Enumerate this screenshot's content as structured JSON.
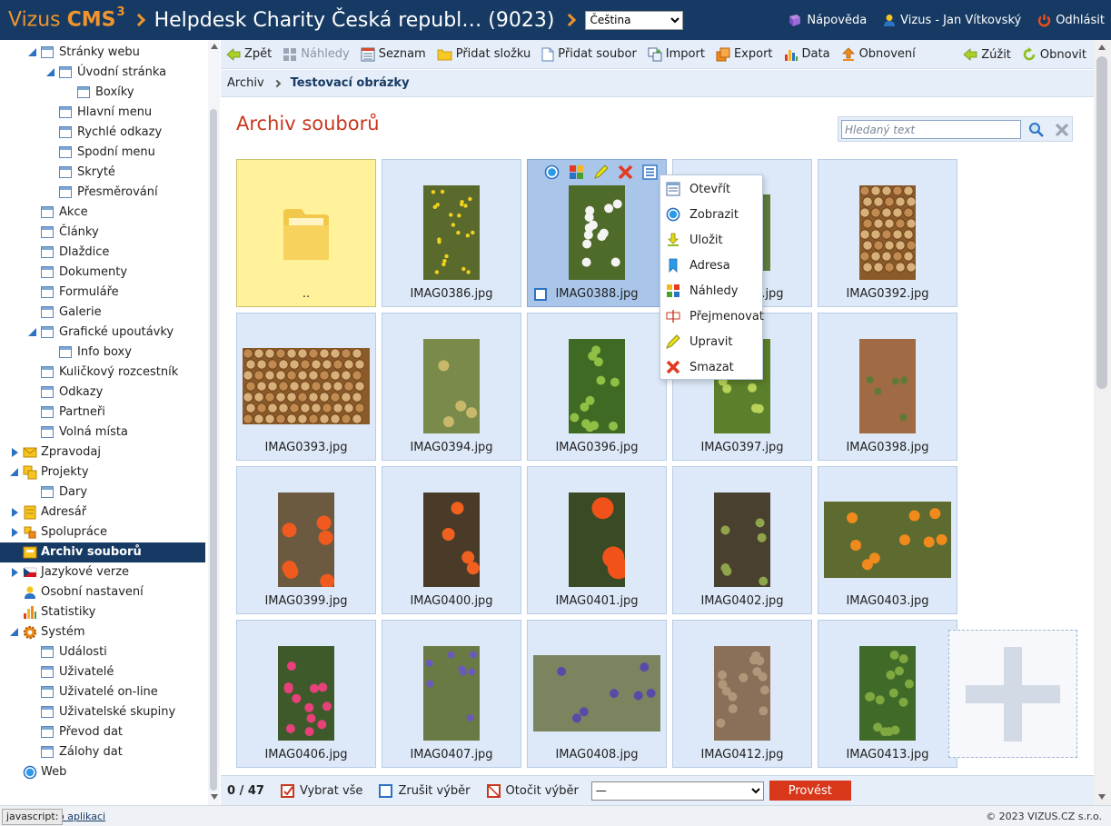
{
  "header": {
    "brand_name": "Vizus",
    "brand_product": "CMS",
    "brand_version": "3",
    "site_title": "Helpdesk Charity Česká republ… (9023)",
    "language": "Čeština",
    "help_label": "Nápověda",
    "user_label": "Vizus - Jan Vítkovský",
    "logout_label": "Odhlásit"
  },
  "sidebar": {
    "items": [
      {
        "label": "Stránky webu",
        "level": 2,
        "icon": "page",
        "expander": "open"
      },
      {
        "label": "Úvodní stránka",
        "level": 3,
        "icon": "page",
        "expander": "open"
      },
      {
        "label": "Boxíky",
        "level": 4,
        "icon": "page"
      },
      {
        "label": "Hlavní menu",
        "level": 3,
        "icon": "page"
      },
      {
        "label": "Rychlé odkazy",
        "level": 3,
        "icon": "page"
      },
      {
        "label": "Spodní menu",
        "level": 3,
        "icon": "page"
      },
      {
        "label": "Skryté",
        "level": 3,
        "icon": "page"
      },
      {
        "label": "Přesměrování",
        "level": 3,
        "icon": "page"
      },
      {
        "label": "Akce",
        "level": 2,
        "icon": "page"
      },
      {
        "label": "Články",
        "level": 2,
        "icon": "page"
      },
      {
        "label": "Dlaždice",
        "level": 2,
        "icon": "page"
      },
      {
        "label": "Dokumenty",
        "level": 2,
        "icon": "page"
      },
      {
        "label": "Formuláře",
        "level": 2,
        "icon": "page"
      },
      {
        "label": "Galerie",
        "level": 2,
        "icon": "page"
      },
      {
        "label": "Grafické upoutávky",
        "level": 2,
        "icon": "page",
        "expander": "open"
      },
      {
        "label": "Info boxy",
        "level": 3,
        "icon": "page"
      },
      {
        "label": "Kuličkový rozcestník",
        "level": 2,
        "icon": "page"
      },
      {
        "label": "Odkazy",
        "level": 2,
        "icon": "page"
      },
      {
        "label": "Partneři",
        "level": 2,
        "icon": "page"
      },
      {
        "label": "Volná místa",
        "level": 2,
        "icon": "page"
      },
      {
        "label": "Zpravodaj",
        "level": 1,
        "icon": "envelope",
        "expander": "closed"
      },
      {
        "label": "Projekty",
        "level": 1,
        "icon": "projects",
        "expander": "open"
      },
      {
        "label": "Dary",
        "level": 2,
        "icon": "page"
      },
      {
        "label": "Adresář",
        "level": 1,
        "icon": "address",
        "expander": "closed"
      },
      {
        "label": "Spolupráce",
        "level": 1,
        "icon": "cooperation",
        "expander": "closed"
      },
      {
        "label": "Archiv souborů",
        "level": 1,
        "icon": "archive",
        "selected": true
      },
      {
        "label": "Jazykové verze",
        "level": 1,
        "icon": "flag",
        "expander": "closed"
      },
      {
        "label": "Osobní nastavení",
        "level": 1,
        "icon": "user"
      },
      {
        "label": "Statistiky",
        "level": 1,
        "icon": "stats"
      },
      {
        "label": "Systém",
        "level": 1,
        "icon": "gear",
        "expander": "open"
      },
      {
        "label": "Události",
        "level": 2,
        "icon": "page"
      },
      {
        "label": "Uživatelé",
        "level": 2,
        "icon": "page"
      },
      {
        "label": "Uživatelé on-line",
        "level": 2,
        "icon": "page"
      },
      {
        "label": "Uživatelské skupiny",
        "level": 2,
        "icon": "page"
      },
      {
        "label": "Převod dat",
        "level": 2,
        "icon": "page"
      },
      {
        "label": "Zálohy dat",
        "level": 2,
        "icon": "page"
      },
      {
        "label": "Web",
        "level": 1,
        "icon": "web"
      }
    ]
  },
  "toolbar": {
    "back": "Zpět",
    "thumbnails": "Náhledy",
    "list": "Seznam",
    "add_folder": "Přidat složku",
    "add_file": "Přidat soubor",
    "import": "Import",
    "export": "Export",
    "data": "Data",
    "refresh": "Obnovení",
    "narrow": "Zúžit",
    "reload": "Obnovit"
  },
  "breadcrumb": {
    "root": "Archiv",
    "current": "Testovací obrázky"
  },
  "main": {
    "title": "Archiv souborů",
    "search_placeholder": "Hledaný text",
    "folder_up_label": "..",
    "files": [
      {
        "name": "IMAG0386.jpg",
        "thumb": "yellowflowers"
      },
      {
        "name": "IMAG0388.jpg",
        "thumb": "whiteblossom",
        "selected": true
      },
      {
        "name": "IMAG0390.jpg",
        "thumb": "dandelion"
      },
      {
        "name": "IMAG0392.jpg",
        "thumb": "woodpile"
      },
      {
        "name": "IMAG0393.jpg",
        "thumb": "woodpile_wide"
      },
      {
        "name": "IMAG0394.jpg",
        "thumb": "plant_light"
      },
      {
        "name": "IMAG0396.jpg",
        "thumb": "parsley"
      },
      {
        "name": "IMAG0397.jpg",
        "thumb": "leafy"
      },
      {
        "name": "IMAG0398.jpg",
        "thumb": "stem"
      },
      {
        "name": "IMAG0399.jpg",
        "thumb": "ranunculus"
      },
      {
        "name": "IMAG0400.jpg",
        "thumb": "ranunculus_pot"
      },
      {
        "name": "IMAG0401.jpg",
        "thumb": "ranunculus_big"
      },
      {
        "name": "IMAG0402.jpg",
        "thumb": "plant_dark"
      },
      {
        "name": "IMAG0403.jpg",
        "thumb": "marigold_wide"
      },
      {
        "name": "IMAG0406.jpg",
        "thumb": "pink"
      },
      {
        "name": "IMAG0407.jpg",
        "thumb": "hyacinth"
      },
      {
        "name": "IMAG0408.jpg",
        "thumb": "hyacinth_wide"
      },
      {
        "name": "IMAG0412.jpg",
        "thumb": "cobble"
      },
      {
        "name": "IMAG0413.jpg",
        "thumb": "ivy"
      }
    ]
  },
  "context_menu": {
    "items": [
      {
        "label": "Otevřít",
        "icon": "open"
      },
      {
        "label": "Zobrazit",
        "icon": "view"
      },
      {
        "label": "Uložit",
        "icon": "save"
      },
      {
        "label": "Adresa",
        "icon": "bookmark"
      },
      {
        "label": "Náhledy",
        "icon": "thumbnails"
      },
      {
        "label": "Přejmenovat",
        "icon": "rename"
      },
      {
        "label": "Upravit",
        "icon": "edit"
      },
      {
        "label": "Smazat",
        "icon": "delete"
      }
    ]
  },
  "bottom": {
    "count": "0 / 47",
    "select_all": "Vybrat vše",
    "deselect": "Zrušit výběr",
    "invert": "Otočit výběr",
    "action_value": "—",
    "run": "Provést"
  },
  "footer": {
    "status_tip": "javascript:",
    "app_link": "o aplikaci",
    "copyright": "© 2023 VIZUS.CZ s.r.o."
  },
  "colors": {
    "header_bg": "#163a63",
    "brand_orange": "#f0952d",
    "title_red": "#c9371f",
    "tile_bg": "#dde9f8",
    "button_red": "#d8371a"
  }
}
